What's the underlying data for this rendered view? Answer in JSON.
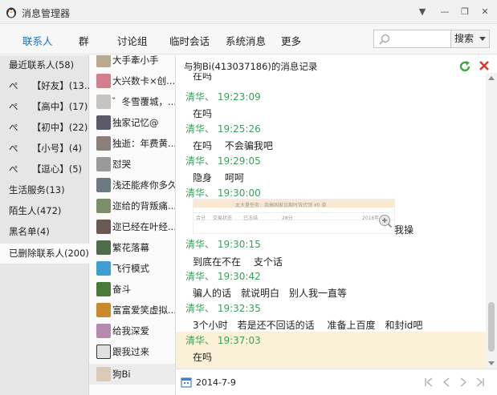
{
  "window": {
    "title": "消息管理器",
    "controls": [
      "▼",
      "—",
      "❐",
      "✕"
    ]
  },
  "nav": {
    "tabs": [
      "联系人",
      "群",
      "讨论组",
      "临时会话",
      "系统消息",
      "更多"
    ],
    "search_placeholder": "",
    "search_button": "搜索"
  },
  "categories": [
    "最近联系人(58)",
    "ぺ　　【好友】(13...",
    "ぺ　　【高中】(17)",
    "ぺ　　【初中】(22)",
    "ぺ　　【小号】(4)",
    "ぺ　　【逗心】(5)",
    "生活服务(13)",
    "陌生人(472)",
    "黑名单(4)",
    "已删除联系人(200)"
  ],
  "contacts": [
    "大手牽小手",
    "大兴数卡×创...",
    "゛冬雪覆城，...",
    "独家记忆@",
    "独逝：年费黄...",
    "怼哭",
    "浅还能疼你多久",
    "迩给的背叛痛...",
    "迩已经在叶经...",
    "繁花落幕",
    "飞行模式",
    "奋斗",
    "富富爱笑虚拟...",
    "给我深爱",
    "跟我过来",
    "狗Bi"
  ],
  "record": {
    "title": "与狗Bi(413037186)的消息记录",
    "top_partial": "在吗",
    "messages": [
      {
        "head": "清华、 19:23:09",
        "text": "在吗"
      },
      {
        "head": "清华、 19:25:26",
        "text": "在吗　 不会骗我吧"
      },
      {
        "head": "清华、 19:29:05",
        "text": "隐身　 呵呵"
      },
      {
        "head": "清华、 19:30:00",
        "text": "我操"
      },
      {
        "head": "清华、 19:30:15",
        "text": "到底在不在　 支个话"
      },
      {
        "head": "清华、 19:30:42",
        "text": "骗人的话　就说明白　别人我一直等"
      },
      {
        "head": "清华、 19:32:35",
        "text": "3个小时　若是还不回话的话　 准备上百度　和封id吧"
      },
      {
        "head": "清华、 19:37:03",
        "text": "在吗"
      }
    ],
    "shot_line1": "太大量任务：我搞国家日期时效代领 ¥0 单",
    "shot_col1": "合分",
    "shot_col2": "交易状态",
    "shot_col3": "已冻结",
    "shot_col4": "28分",
    "shot_col5": "2016年",
    "date": "2014-7-9"
  },
  "colors": {
    "accent": "#1c6fbf",
    "timestamp": "#3aa05a",
    "highlight": "#fbf1d8"
  }
}
